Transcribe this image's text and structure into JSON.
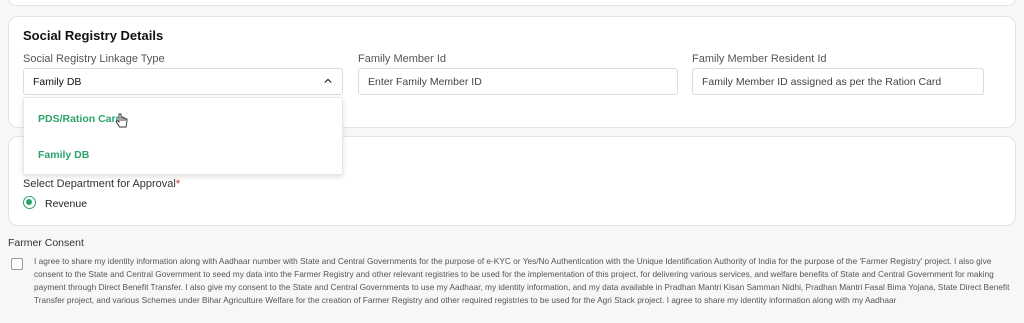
{
  "section": {
    "title": "Social Registry Details"
  },
  "fields": {
    "linkage_type": {
      "label": "Social Registry Linkage Type",
      "value": "Family DB"
    },
    "family_member_id": {
      "label": "Family Member Id",
      "placeholder": "Enter Family Member ID"
    },
    "family_member_resident_id": {
      "label": "Family Member Resident Id",
      "placeholder": "Family Member ID assigned as per the Ration Card"
    }
  },
  "dropdown": {
    "options": [
      "PDS/Ration Card",
      "Family DB"
    ]
  },
  "department": {
    "label": "Select Department for Approval",
    "required_mark": "*",
    "option": "Revenue"
  },
  "consent": {
    "title": "Farmer Consent",
    "text": "I agree to share my identity information along with Aadhaar number with State and Central Governments for the purpose of e-KYC or Yes/No Authentication with the Unique Identification Authority of India for the purpose of the 'Farmer Registry' project. I also give consent to the State and Central Government to seed my data into the Farmer Registry and other relevant registries to be used for the implementation of this project, for delivering various services, and welfare benefits of State and Central Government for making payment through Direct Benefit Transfer. I also give my consent to the State and Central Governments to use my Aadhaar, my identity information, and my data available in Pradhan Mantri Kisan Samman Nidhi, Pradhan Mantri Fasal Bima Yojana, State Direct Benefit Transfer project, and various Schemes under Bihar Agriculture Welfare for the creation of Farmer Registry and other required registries to be used for the Agri Stack project. I agree to share my identity information along with my Aadhaar"
  },
  "colors": {
    "accent": "#2aa36a",
    "required": "#d32f2f"
  }
}
